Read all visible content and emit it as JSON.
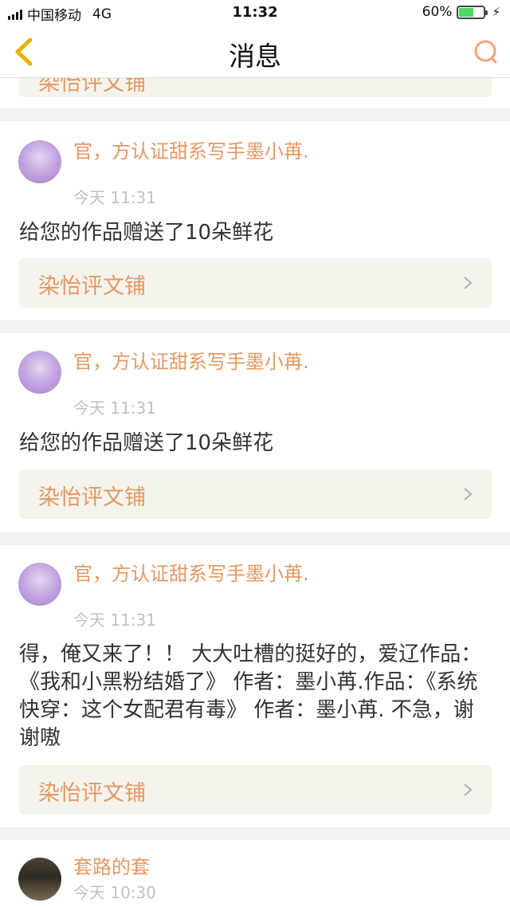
{
  "status_bar": {
    "carrier": "中国移动",
    "network": "4G",
    "time": "11:32",
    "battery": "60%",
    "battery_level": 0.6
  },
  "nav": {
    "title": "消息",
    "back_icon": "chevron-left-icon",
    "search_icon": "search-icon"
  },
  "peek_link": "染怡评文铺",
  "messages": [
    {
      "sender": "官，方认证甜系写手墨小苒.",
      "time": "今天 11:31",
      "content": "给您的作品赠送了10朵鲜花",
      "link": "染怡评文铺"
    },
    {
      "sender": "官，方认证甜系写手墨小苒.",
      "time": "今天 11:31",
      "content": "给您的作品赠送了10朵鲜花",
      "link": "染怡评文铺"
    },
    {
      "sender": "官，方认证甜系写手墨小苒.",
      "time": "今天 11:31",
      "content": "得，俺又来了！！ 大大吐槽的挺好的，爱辽作品：《我和小黑粉结婚了》 作者：墨小苒.作品：《系统快穿：这个女配君有毒》 作者：墨小苒. 不急，谢谢嗷",
      "link": "染怡评文铺"
    },
    {
      "sender": "套路的套",
      "time": "今天 10:30"
    }
  ],
  "colors": {
    "accent": "#e59863",
    "link_bg": "#f4f4ec",
    "back_icon": "#e6b400",
    "search_icon": "#f4a27a",
    "page_bg": "#f2f2f2"
  }
}
